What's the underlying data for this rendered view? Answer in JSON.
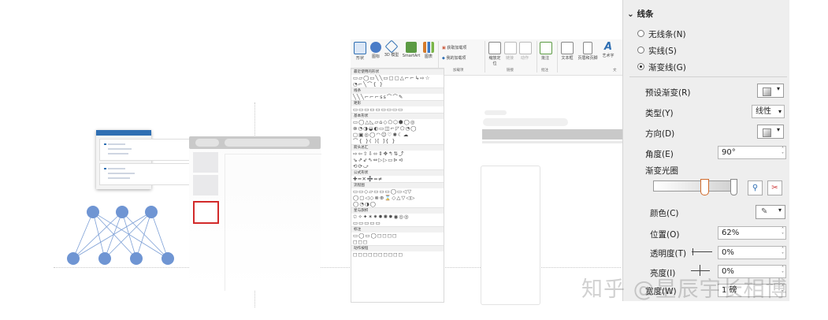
{
  "gallery": {
    "sections": [
      "最近使用的形状",
      "线条",
      "矩形",
      "基本形状",
      "箭头总汇",
      "公式形状",
      "流程图",
      "星与旗帜",
      "标注",
      "动作按钮"
    ],
    "rows": [
      "▭▱◯▭╲╲▭▢▢△⌐⌐↳⇨☆",
      "◔⌐╲⌒{ }",
      "╲╲╲⌐⌐⌐ꜱꜱ⌒⌒✎",
      "▭▭▭▭▭▭▭▭▭",
      "▭◯△◺▱⌂◇⬠⬡⬢◯◎",
      "⊗◔◑◒◐▭◫⌐◸⬠◔◯",
      "▢▣◎◯◠☺♡✺☾☁",
      "⌒{ }( )[ ]{ }",
      "⇨⇦⇧⇩⬄⇕✥↰⇅⤴",
      "⇘⇗⇙⇖⇔▷▷▭⊳⊲",
      "⟲⟳⤻",
      "✚━✕➗═≠",
      "▭▭◇▱▭▭▭◯▭◁▽",
      "◯▢◁◇⊗⊕⌛◇△▽◁▷",
      "◯◔◑◯",
      "✩✧✦✶✷✹✺✸◉◎◎",
      "▭▭▭▭▭",
      "▭◯▭◯◻◻◻◻",
      "◻◻◻",
      "◻◻◻◻◻◻◻◻◻◻"
    ]
  },
  "ribbon": {
    "buttons": [
      "形状",
      "图标",
      "3D 模型",
      "SmartArt",
      "图表"
    ],
    "addins": [
      "获取加载项",
      "我的加载项"
    ],
    "groups": [
      "加载项",
      "链接",
      "批注",
      "文"
    ],
    "mid_buttons": [
      "缩放定位",
      "链接",
      "动作",
      "批注",
      "文本框",
      "页眉和页脚",
      "艺术字"
    ]
  },
  "pane": {
    "header": "线条",
    "radios": [
      {
        "label": "无线条(N)",
        "selected": false
      },
      {
        "label": "实线(S)",
        "selected": false
      },
      {
        "label": "渐变线(G)",
        "selected": true
      }
    ],
    "preset_label": "预设渐变(R)",
    "type_label": "类型(Y)",
    "type_value": "线性",
    "direction_label": "方向(D)",
    "angle_label": "角度(E)",
    "angle_value": "90°",
    "stops_label": "渐变光圈",
    "color_label": "颜色(C)",
    "position_label": "位置(O)",
    "position_value": "62%",
    "transparency_label": "透明度(T)",
    "transparency_value": "0%",
    "brightness_label": "亮度(I)",
    "brightness_value": "0%",
    "width_label": "宽度(W)",
    "width_value": "1 磅"
  },
  "watermark": "知乎 @星辰宇长相博",
  "colors": {
    "accent": "#2f6fb3",
    "node": "#6f95d3",
    "selection": "#d22a2a"
  }
}
